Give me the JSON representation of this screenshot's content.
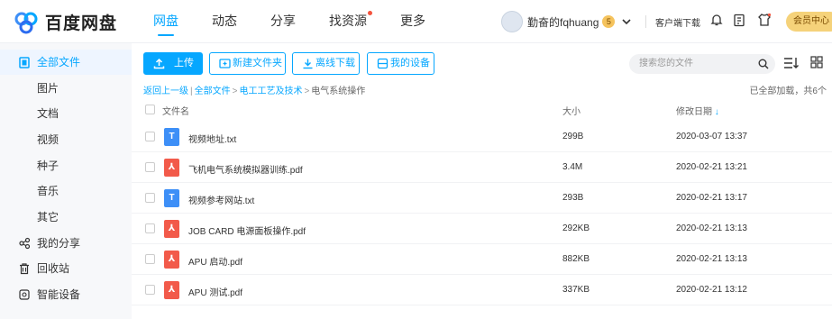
{
  "header": {
    "logo_text": "百度网盘",
    "nav": [
      {
        "label": "网盘",
        "active": true
      },
      {
        "label": "动态"
      },
      {
        "label": "分享"
      },
      {
        "label": "找资源",
        "dot": true
      },
      {
        "label": "更多"
      }
    ],
    "username": "勤奋的fqhuang",
    "vip_level": "5",
    "client_download": "客户端下载",
    "member_center": "会员中心"
  },
  "sidebar": {
    "items": [
      {
        "label": "全部文件",
        "icon": "folder-icon",
        "active": true
      },
      {
        "label": "图片"
      },
      {
        "label": "文档"
      },
      {
        "label": "视频"
      },
      {
        "label": "种子"
      },
      {
        "label": "音乐"
      },
      {
        "label": "其它"
      },
      {
        "label": "我的分享",
        "icon": "share-icon"
      },
      {
        "label": "回收站",
        "icon": "trash-icon"
      },
      {
        "label": "智能设备",
        "icon": "device-icon"
      }
    ]
  },
  "toolbar": {
    "upload": "上传",
    "new_folder": "新建文件夹",
    "offline_download": "离线下载",
    "my_devices": "我的设备",
    "search_placeholder": "搜索您的文件"
  },
  "breadcrumb": {
    "back": "返回上一级",
    "items": [
      "全部文件",
      "电工工艺及技术"
    ],
    "current": "电气系统操作"
  },
  "count_text": "已全部加载，共6个",
  "table": {
    "headers": {
      "name": "文件名",
      "size": "大小",
      "date": "修改日期"
    },
    "rows": [
      {
        "name": "视频地址.txt",
        "type": "txt",
        "size": "299B",
        "date": "2020-03-07 13:37"
      },
      {
        "name": "飞机电气系统模拟器训练.pdf",
        "type": "pdf",
        "size": "3.4M",
        "date": "2020-02-21 13:21"
      },
      {
        "name": "视频参考网站.txt",
        "type": "txt",
        "size": "293B",
        "date": "2020-02-21 13:17"
      },
      {
        "name": "JOB CARD 电源面板操作.pdf",
        "type": "pdf",
        "size": "292KB",
        "date": "2020-02-21 13:13"
      },
      {
        "name": "APU 启动.pdf",
        "type": "pdf",
        "size": "882KB",
        "date": "2020-02-21 13:13"
      },
      {
        "name": "APU 测试.pdf",
        "type": "pdf",
        "size": "337KB",
        "date": "2020-02-21 13:12"
      }
    ]
  },
  "colors": {
    "accent": "#06a7ff",
    "pdf": "#f25a4a",
    "txt": "#3d8ff7"
  }
}
